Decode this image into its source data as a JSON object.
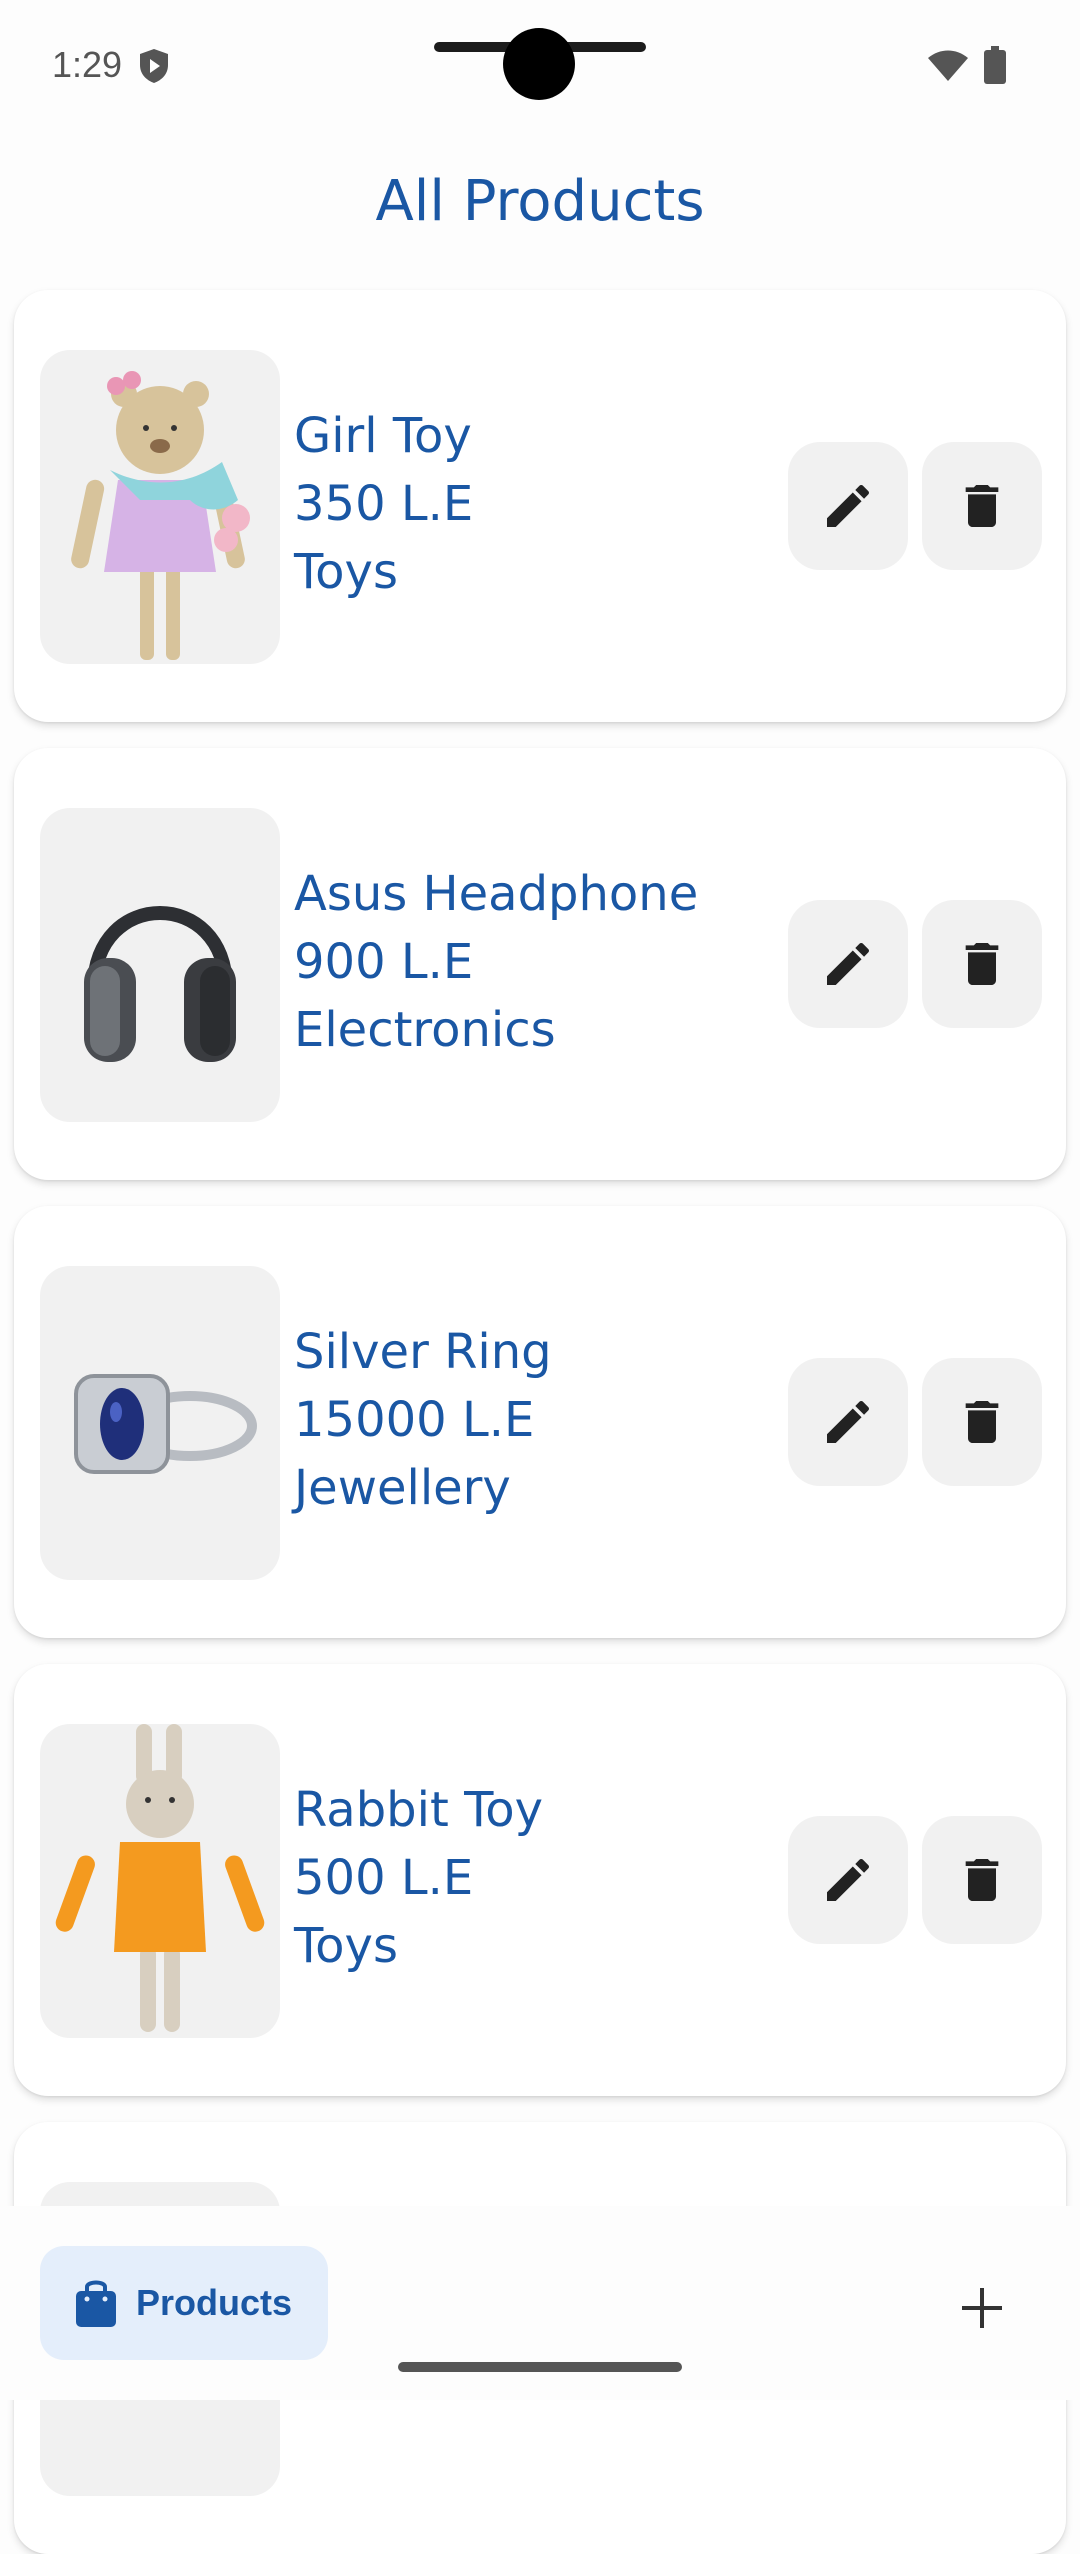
{
  "status_bar": {
    "time": "1:29"
  },
  "header": {
    "title": "All Products"
  },
  "products": [
    {
      "name": "Girl Toy",
      "price": "350 L.E",
      "category": "Toys"
    },
    {
      "name": "Asus Headphone",
      "price": "900 L.E",
      "category": "Electronics"
    },
    {
      "name": "Silver Ring",
      "price": "15000 L.E",
      "category": "Jewellery"
    },
    {
      "name": "Rabbit Toy",
      "price": "500 L.E",
      "category": "Toys"
    }
  ],
  "bottom_nav": {
    "products_label": "Products",
    "add_icon": "plus-icon",
    "products_icon": "shopping-bag-icon"
  },
  "colors": {
    "accent": "#1a57a4",
    "nav_selected_bg": "#e4eefb",
    "button_bg": "#f1f1f1"
  }
}
